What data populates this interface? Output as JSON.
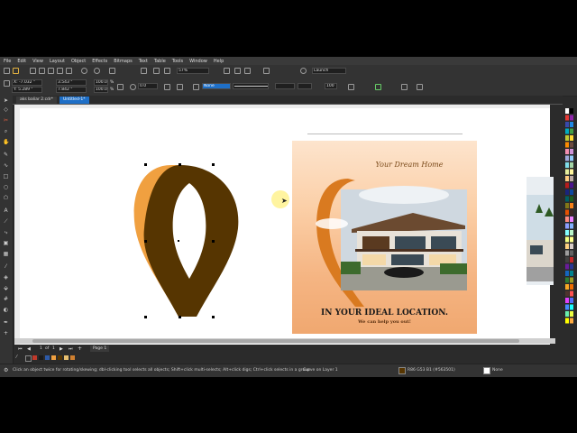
{
  "menu": [
    "File",
    "Edit",
    "View",
    "Layout",
    "Object",
    "Effects",
    "Bitmaps",
    "Text",
    "Table",
    "Tools",
    "Window",
    "Help"
  ],
  "toolbar": {
    "zoom": "57%",
    "launch_label": "Launch"
  },
  "property_bar": {
    "x": "X: -7.032 \"",
    "y": "Y: 5.289 \"",
    "width": "3.543 \"",
    "height": "7.842 \"",
    "scale_w": "100.0",
    "scale_h": "100.0",
    "unit": "%",
    "rotation": "0.0",
    "outline_width": "None",
    "size": "100"
  },
  "tabs": [
    {
      "label": "aks baliar 2.cdr*"
    },
    {
      "label": "Untitled-1*"
    }
  ],
  "poster": {
    "tagline": "Your Dream Home",
    "headline": "IN YOUR IDEAL LOCATION.",
    "sub": "We can help you out!"
  },
  "page_nav": {
    "current": "1",
    "of": "of",
    "total": "1",
    "page_tab": "Page 1"
  },
  "status": {
    "hint": "Click an object twice for rotating/skewing; dbl-clicking tool selects all objects; Shift+click multi-selects; Alt+click digs; Ctrl+click selects in a group",
    "layer": "Curve on Layer 1",
    "fill": "R86 G53 B1 (#563501)",
    "outline": "None"
  },
  "colors": {
    "pin_front": "#563501",
    "pin_side": "#f0a040",
    "accent_tab": "#1e6fc7"
  },
  "icons": [
    "pick-tool-icon",
    "shape-tool-icon",
    "crop-tool-icon",
    "zoom-tool-icon",
    "freehand-tool-icon",
    "rectangle-tool-icon",
    "ellipse-tool-icon",
    "polygon-tool-icon",
    "text-tool-icon",
    "eyedropper-tool-icon",
    "fill-tool-icon",
    "hand-tool-icon"
  ]
}
